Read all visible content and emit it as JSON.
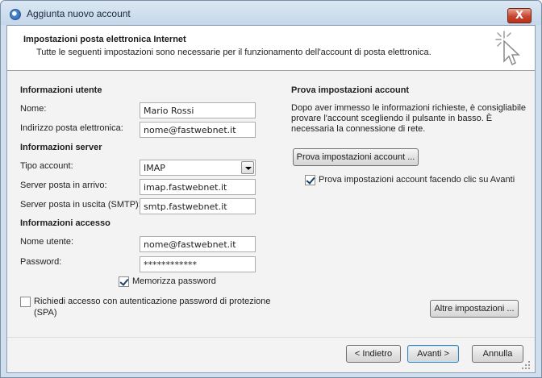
{
  "window": {
    "title": "Aggiunta nuovo account",
    "close_label": "X",
    "icon": "outlook-globe-icon"
  },
  "header": {
    "title": "Impostazioni posta elettronica Internet",
    "subtitle": "Tutte le seguenti impostazioni sono necessarie per il funzionamento dell'account di posta elettronica.",
    "icon": "cursor-sparkle-icon"
  },
  "user_info": {
    "heading": "Informazioni utente",
    "name_label": "Nome:",
    "name_value": "Mario Rossi",
    "email_label": "Indirizzo posta elettronica:",
    "email_value": "nome@fastwebnet.it"
  },
  "server_info": {
    "heading": "Informazioni server",
    "account_type_label": "Tipo account:",
    "account_type_value": "IMAP",
    "incoming_label": "Server posta in arrivo:",
    "incoming_value": "imap.fastwebnet.it",
    "outgoing_label": "Server posta in uscita (SMTP):",
    "outgoing_value": "smtp.fastwebnet.it"
  },
  "login_info": {
    "heading": "Informazioni accesso",
    "username_label": "Nome utente:",
    "username_value": "nome@fastwebnet.it",
    "password_label": "Password:",
    "password_value": "************",
    "remember_label": "Memorizza password",
    "remember_checked": true,
    "spa_label_line1": "Richiedi accesso con autenticazione password di protezione",
    "spa_label_line2": "(SPA)",
    "spa_checked": false
  },
  "test": {
    "heading": "Prova impostazioni account",
    "description_line1": "Dopo aver immesso le informazioni richieste, è consigliabile",
    "description_line2": "provare l'account scegliendo il pulsante in basso. È",
    "description_line3": "necessaria la connessione di rete.",
    "test_button": "Prova impostazioni account ...",
    "auto_test_label": "Prova impostazioni account facendo clic su Avanti",
    "auto_test_checked": true,
    "more_settings_button": "Altre impostazioni ..."
  },
  "footer": {
    "back_button": "< Indietro",
    "next_button": "Avanti >",
    "cancel_button": "Annulla"
  },
  "colors": {
    "title_bar": "#c5d7ea",
    "client_bg": "#f3f3f3",
    "close_button": "#c7452e"
  }
}
